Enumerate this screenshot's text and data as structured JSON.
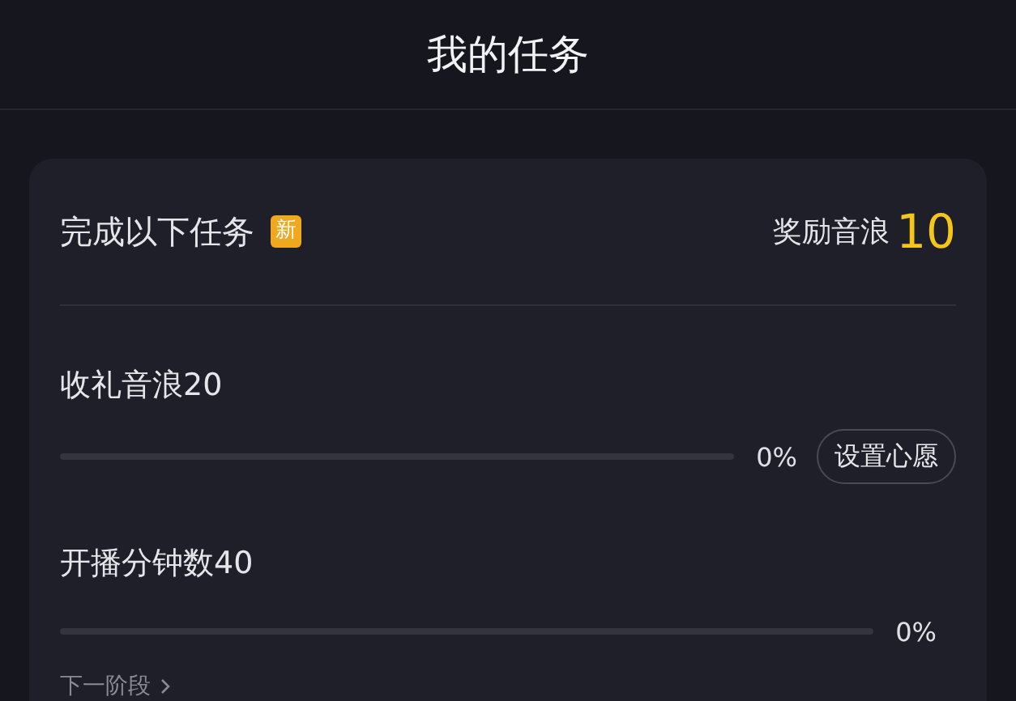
{
  "header": {
    "title": "我的任务"
  },
  "card": {
    "heading": "完成以下任务",
    "badge": "新",
    "reward_label": "奖励音浪",
    "reward_value": "10",
    "tasks": [
      {
        "name": "收礼音浪20",
        "level": 0,
        "reading": "0%",
        "button": "设置心愿"
      },
      {
        "name": "开播分钟数40",
        "level": 0,
        "reading": "0%"
      }
    ],
    "next_link": "下一阶段"
  }
}
